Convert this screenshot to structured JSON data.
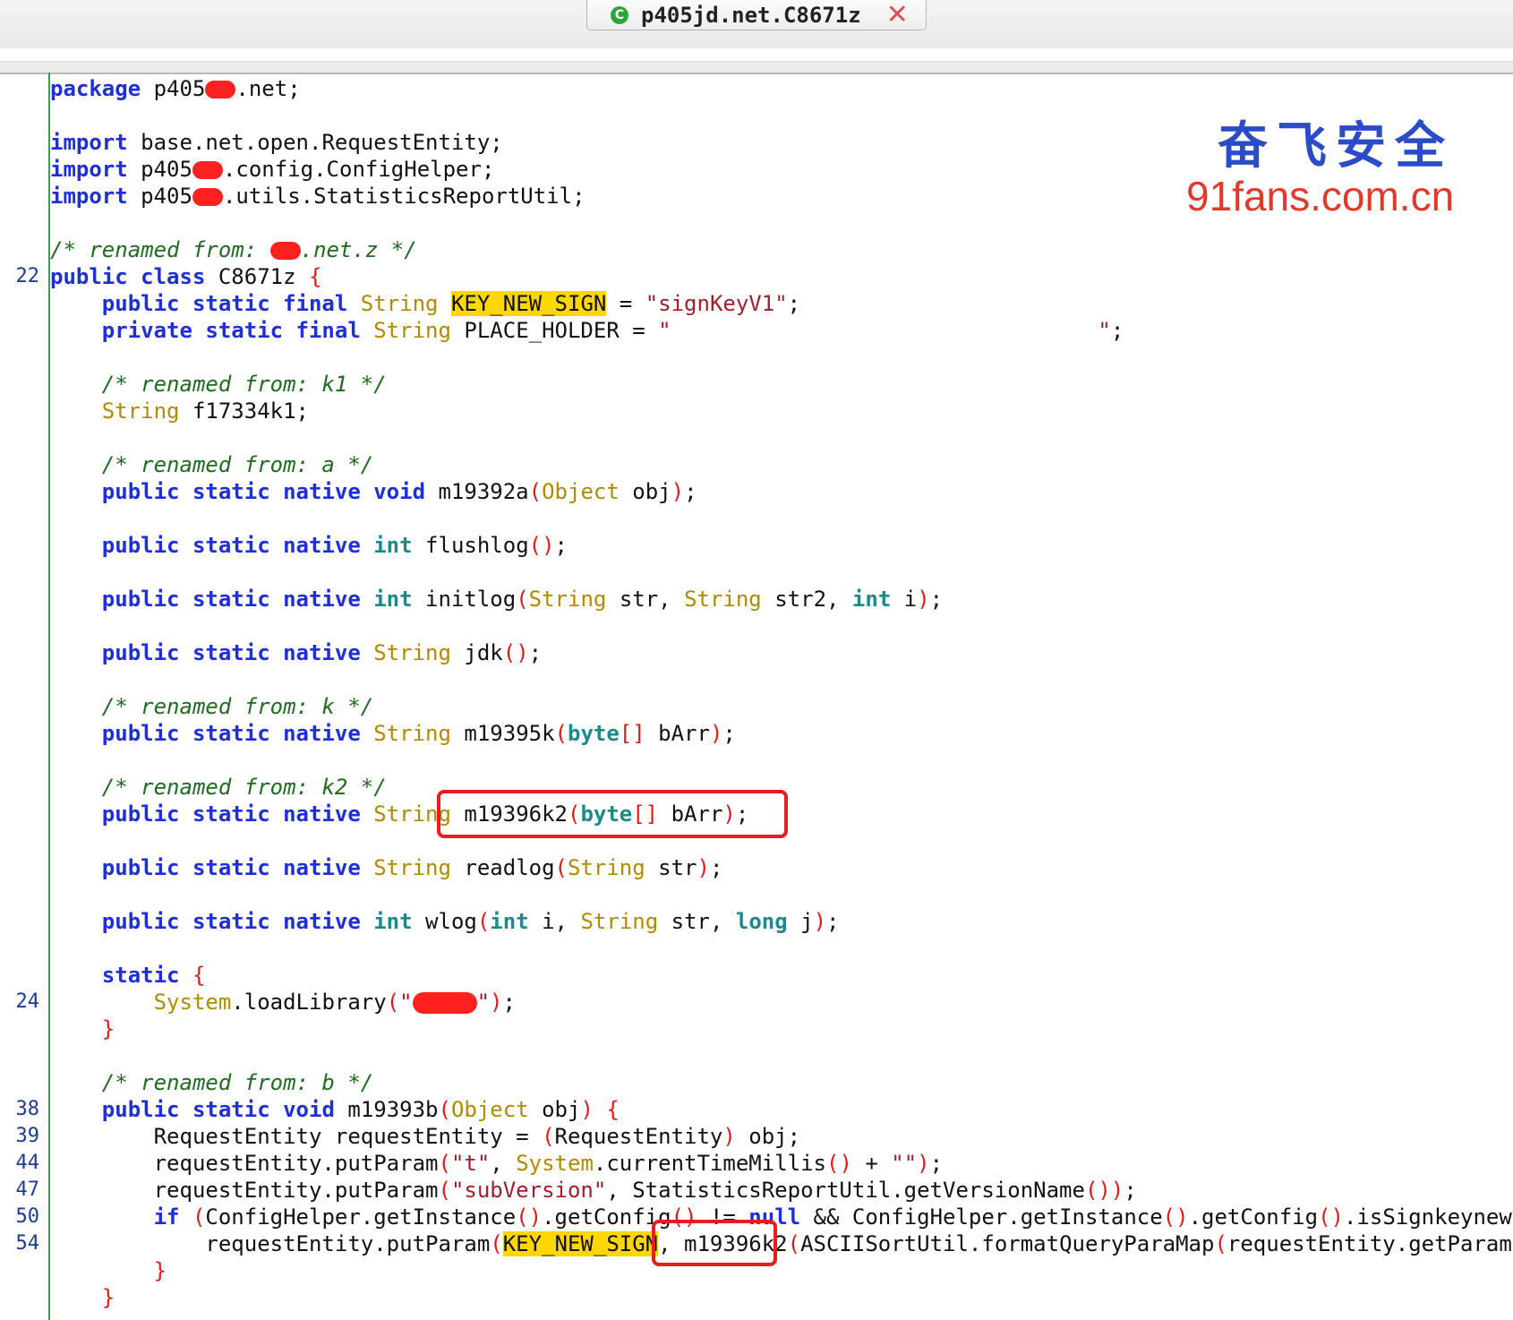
{
  "tab": {
    "title": "p405jd.net.C8671z",
    "icon": "class-icon",
    "close": "✕"
  },
  "watermark": {
    "cn": "奋飞安全",
    "url": "91fans.com.cn"
  },
  "line_numbers": {
    "l22": "22",
    "l24": "24",
    "l38": "38",
    "l39": "39",
    "l44": "44",
    "l47": "47",
    "l50": "50",
    "l54": "54"
  },
  "code": {
    "package_kw": "package",
    "package_a": "p405",
    "package_b": ".net;",
    "import_kw": "import",
    "import1": "base.net.open.RequestEntity;",
    "import2_a": "p405",
    "import2_b": ".config.ConfigHelper;",
    "import3_a": "p405",
    "import3_b": ".utils.StatisticsReportUtil;",
    "renamed_cls_a": "/* renamed from: ",
    "renamed_cls_b": ".net.z */",
    "cls_public": "public",
    "cls_class": "class",
    "cls_name": "C8671z",
    "brace_open": "{",
    "f1_mods": "public static final",
    "f1_type": "String",
    "f1_name": "KEY_NEW_SIGN",
    "f1_eq": " = ",
    "f1_val": "\"signKeyV1\"",
    "semi": ";",
    "f2_mods": "private static final",
    "f2_type": "String",
    "f2_name": "PLACE_HOLDER",
    "f2_val_open": "\"",
    "f2_val_close": "\"",
    "c_k1": "/* renamed from: k1 */",
    "f3_type": "String",
    "f3_name": "f17334k1;",
    "c_a": "/* renamed from: a */",
    "native_mods": "public static native",
    "m1_ret": "void",
    "m1_name": "m19392a",
    "m1_ptype": "Object",
    "m1_pname": "obj",
    "m2_ret": "int",
    "m2_name": "flushlog",
    "m3_ret": "int",
    "m3_name": "initlog",
    "m3_p1t": "String",
    "m3_p1": "str,",
    "m3_p2t": "String",
    "m3_p2": "str2,",
    "m3_p3t": "int",
    "m3_p3": "i",
    "m4_ret": "String",
    "m4_name": "jdk",
    "c_k": "/* renamed from: k */",
    "m5_ret": "String",
    "m5_name": "m19395k",
    "m5_ptype": "byte",
    "m5_arr": "[]",
    "m5_pname": "bArr",
    "c_k2": "/* renamed from: k2 */",
    "m6_ret": "String",
    "m6_name": "m19396k2",
    "m6_ptype": "byte",
    "m6_arr": "[]",
    "m6_pname": "bArr",
    "m7_ret": "String",
    "m7_name": "readlog",
    "m7_ptype": "String",
    "m7_pname": "str",
    "m8_ret": "int",
    "m8_name": "wlog",
    "m8_p1t": "int",
    "m8_p1": "i,",
    "m8_p2t": "String",
    "m8_p2": "str,",
    "m8_p3t": "long",
    "m8_p3": "j",
    "static_kw": "static",
    "brace_close": "}",
    "sys": "System",
    "load": ".loadLibrary",
    "c_b": "/* renamed from: b */",
    "mb_mods": "public static",
    "mb_ret": "void",
    "mb_name": "m19393b",
    "mb_ptype": "Object",
    "mb_pname": "obj",
    "l39_a": "RequestEntity requestEntity = ",
    "l39_b": "RequestEntity",
    "l39_c": " obj;",
    "l44_a": "requestEntity.putParam",
    "l44_s": "\"t\"",
    "l44_b": ", ",
    "l44_sys": "System",
    "l44_c": ".currentTimeMillis",
    "l44_d": " + ",
    "l44_e": "\"\"",
    "l47_a": "requestEntity.putParam",
    "l47_s": "\"subVersion\"",
    "l47_b": ", StatisticsReportUtil.getVersionName",
    "l50_if": "if",
    "l50_a": "ConfigHelper.getInstance",
    "l50_b": ".getConfig",
    "l50_ne": " != ",
    "l50_null": "null",
    "l50_and": " && ",
    "l50_c": "ConfigHelper.getInstance",
    "l50_d": ".getConfig",
    "l50_e": ".isSignkeynew",
    "l54_a": "requestEntity.putParam",
    "l54_key": "KEY_NEW_SIGN",
    "l54_comma": ", ",
    "l54_m": "m19396k2",
    "l54_b": "ASCIISortUtil.formatQueryParaMap",
    "l54_c": "requestEntity.getParams"
  }
}
